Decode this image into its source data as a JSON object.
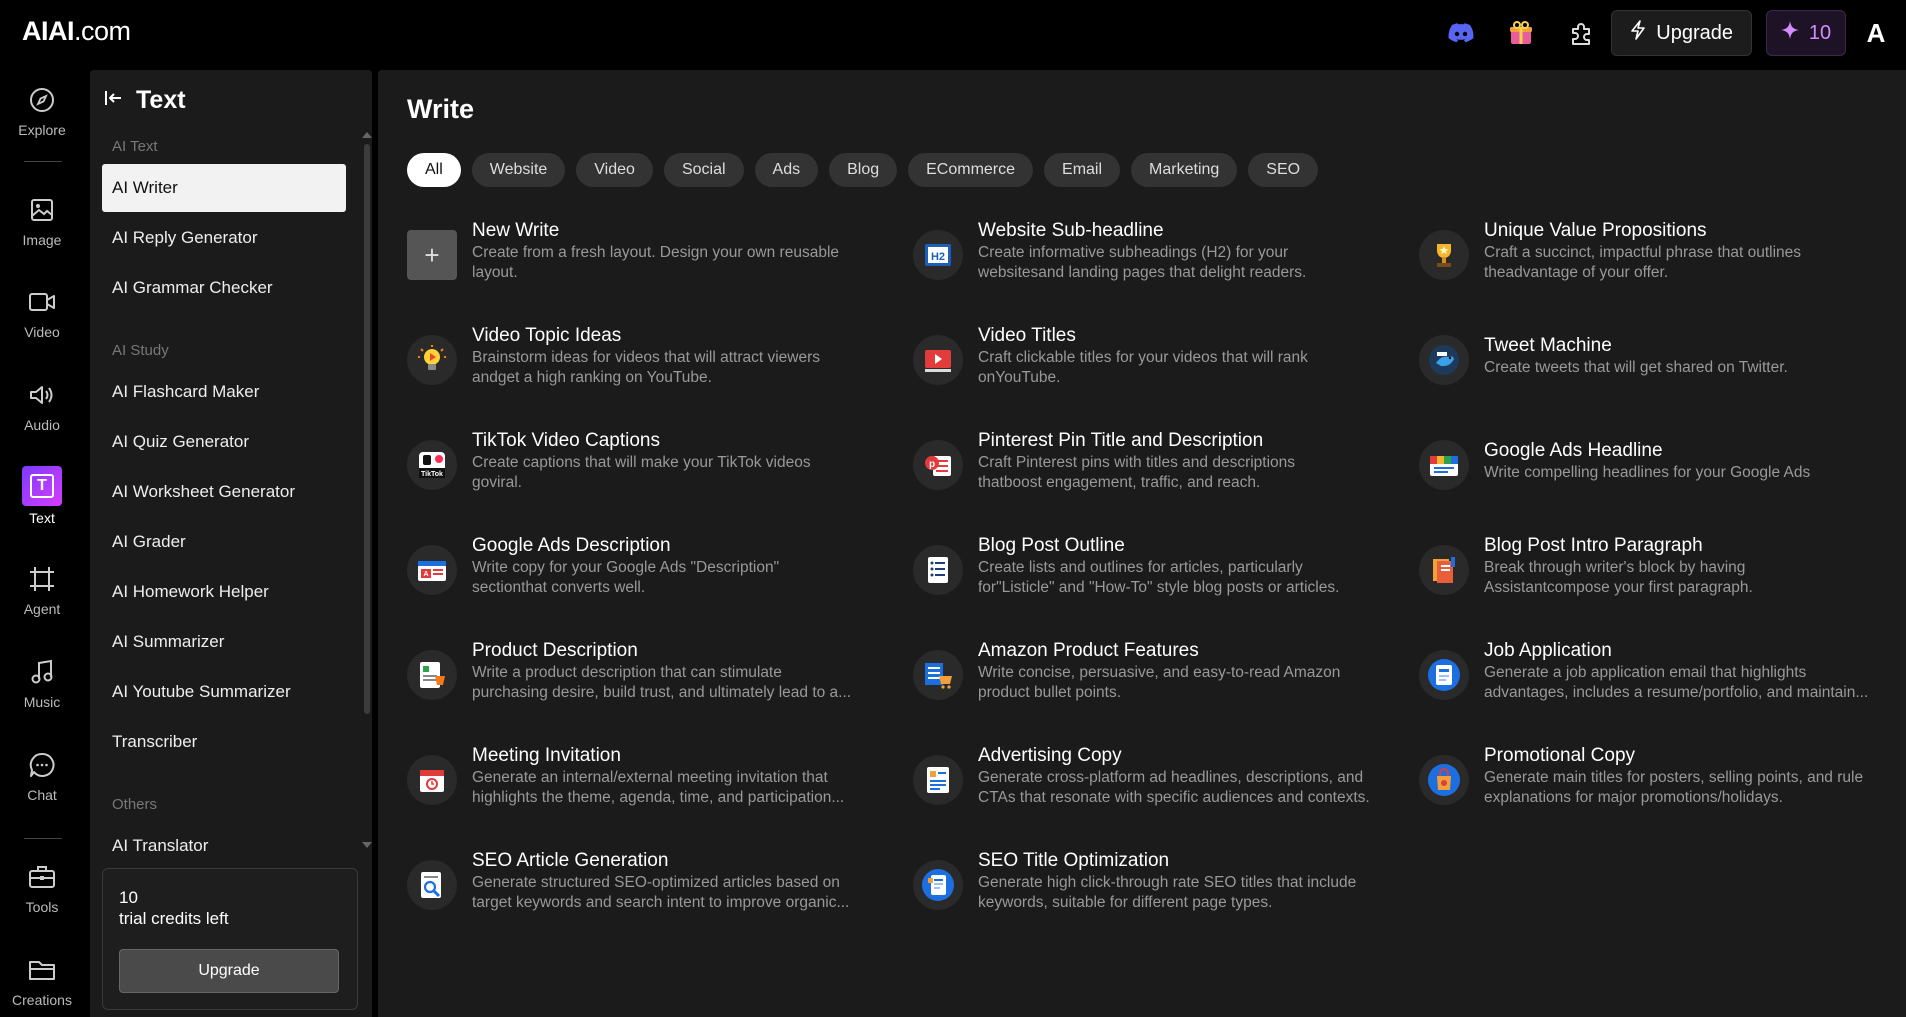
{
  "brand": {
    "logo_main": "AIAI",
    "logo_suffix": ".com"
  },
  "topbar": {
    "upgrade_label": "Upgrade",
    "credits": "10",
    "avatar_letter": "A"
  },
  "rail": [
    {
      "label": "Explore",
      "icon": "compass-icon"
    },
    {
      "label": "Image",
      "icon": "image-icon"
    },
    {
      "label": "Video",
      "icon": "video-icon"
    },
    {
      "label": "Audio",
      "icon": "speaker-icon"
    },
    {
      "label": "Text",
      "icon": "text-icon"
    },
    {
      "label": "Agent",
      "icon": "frame-icon"
    },
    {
      "label": "Music",
      "icon": "music-note-icon"
    },
    {
      "label": "Chat",
      "icon": "chat-bubble-icon"
    },
    {
      "label": "Tools",
      "icon": "toolbox-icon"
    },
    {
      "label": "Creations",
      "icon": "folder-icon"
    }
  ],
  "panel": {
    "title": "Text",
    "section_text": "AI Text",
    "section_study": "AI Study",
    "section_others": "Others",
    "items": [
      "AI Writer",
      "AI Reply Generator",
      "AI Grammar Checker",
      "AI Flashcard Maker",
      "AI Quiz Generator",
      "AI Worksheet Generator",
      "AI Grader",
      "AI Homework Helper",
      "AI Summarizer",
      "AI Youtube Summarizer",
      "Transcriber",
      "AI Translator"
    ],
    "credit_count": "10",
    "credit_text": "trial credits left",
    "credit_upgrade": "Upgrade"
  },
  "main": {
    "title": "Write",
    "chips": [
      "All",
      "Website",
      "Video",
      "Social",
      "Ads",
      "Blog",
      "ECommerce",
      "Email",
      "Marketing",
      "SEO"
    ],
    "cards": [
      {
        "title": "New Write",
        "desc1": "Create from a fresh layout. Design your own reusable",
        "desc2": "layout.",
        "icon": "plus-icon"
      },
      {
        "title": "Website Sub-headline",
        "desc1": "Create informative subheadings (H2) for your",
        "desc2": "websitesand landing pages that delight readers.",
        "icon": "h2-icon"
      },
      {
        "title": "Unique Value Propositions",
        "desc1": "Craft a succinct, impactful phrase that outlines",
        "desc2": "theadvantage of your offer.",
        "icon": "trophy-icon"
      },
      {
        "title": "Video Topic Ideas",
        "desc1": "Brainstorm ideas for videos that will attract viewers",
        "desc2": "andget a high ranking on YouTube.",
        "icon": "lightbulb-icon"
      },
      {
        "title": "Video Titles",
        "desc1": "Craft clickable titles for your videos that will rank",
        "desc2": "onYouTube.",
        "icon": "video-player-icon"
      },
      {
        "title": "Tweet Machine",
        "desc1": "Create tweets that will get shared on Twitter.",
        "desc2": "",
        "icon": "bird-icon"
      },
      {
        "title": "TikTok Video Captions",
        "desc1": "Create captions that will make your TikTok videos",
        "desc2": "goviral.",
        "icon": "tiktok-icon"
      },
      {
        "title": "Pinterest Pin Title and Description",
        "desc1": "Craft Pinterest pins with titles and descriptions",
        "desc2": "thatboost engagement, traffic, and reach.",
        "icon": "pinterest-icon"
      },
      {
        "title": "Google Ads Headline",
        "desc1": "Write compelling headlines for your Google Ads",
        "desc2": "",
        "icon": "ads-headline-icon"
      },
      {
        "title": "Google Ads Description",
        "desc1": "Write copy for your Google Ads \"Description\"",
        "desc2": "sectionthat converts well.",
        "icon": "ads-description-icon"
      },
      {
        "title": "Blog Post Outline",
        "desc1": "Create lists and outlines for articles, particularly",
        "desc2": "for\"Listicle\" and \"How-To\" style blog posts or articles.",
        "icon": "outline-list-icon"
      },
      {
        "title": "Blog Post Intro Paragraph",
        "desc1": "Break through writer's block by having",
        "desc2": "Assistantcompose your first paragraph.",
        "icon": "book-icon"
      },
      {
        "title": "Product Description",
        "desc1": "Write a product description that can stimulate",
        "desc2": "purchasing desire, build trust, and ultimately lead to a...",
        "icon": "product-sheet-icon"
      },
      {
        "title": "Amazon Product Features",
        "desc1": "Write concise, persuasive, and easy-to-read Amazon",
        "desc2": "product bullet points.",
        "icon": "cart-list-icon"
      },
      {
        "title": "Job Application",
        "desc1": "Generate a job application email that highlights",
        "desc2": "advantages, includes a resume/portfolio, and maintain...",
        "icon": "resume-icon"
      },
      {
        "title": "Meeting Invitation",
        "desc1": "Generate an internal/external meeting invitation that",
        "desc2": "highlights the theme, agenda, time, and participation...",
        "icon": "calendar-icon"
      },
      {
        "title": "Advertising Copy",
        "desc1": "Generate cross-platform ad headlines, descriptions, and",
        "desc2": "CTAs that resonate with specific audiences and contexts.",
        "icon": "ad-copy-icon"
      },
      {
        "title": "Promotional Copy",
        "desc1": "Generate main titles for posters, selling points, and rule",
        "desc2": "explanations for major promotions/holidays.",
        "icon": "shopping-bag-icon"
      },
      {
        "title": "SEO Article Generation",
        "desc1": "Generate structured SEO-optimized articles based on",
        "desc2": "target keywords and search intent to improve organic...",
        "icon": "seo-search-icon"
      },
      {
        "title": "SEO Title Optimization",
        "desc1": "Generate high click-through rate SEO titles that include",
        "desc2": "keywords, suitable for different page types.",
        "icon": "seo-doc-icon"
      }
    ]
  },
  "colors": {
    "accent_purple": "#d58cff",
    "discord": "#5865F2",
    "selected_bg": "#f2f2f2"
  }
}
